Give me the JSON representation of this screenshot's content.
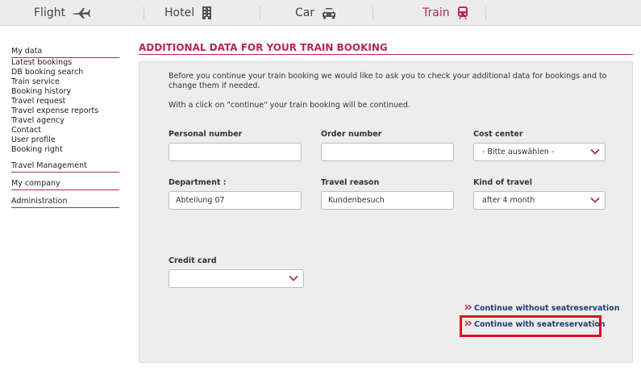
{
  "topnav": {
    "tabs": [
      {
        "label": "Flight",
        "icon": "airplane-icon",
        "active": false
      },
      {
        "label": "Hotel",
        "icon": "building-icon",
        "active": false
      },
      {
        "label": "Car",
        "icon": "car-icon",
        "active": false
      },
      {
        "label": "Train",
        "icon": "train-icon",
        "active": true
      }
    ]
  },
  "sidebar": {
    "my_data": "My data",
    "items": [
      "Latest bookings",
      "DB booking search",
      "Train service",
      "Booking history",
      "Travel request",
      "Travel expense reports",
      "Travel agency",
      "Contact",
      "User profile",
      "Booking right"
    ],
    "travel_management": "Travel Management",
    "my_company": "My company",
    "administration": "Administration"
  },
  "main": {
    "title": "ADDITIONAL DATA FOR YOUR TRAIN BOOKING",
    "intro": "Before you continue your train booking we would like to ask you to check your additional data for bookings and to change them if needed.",
    "intro2": "With a click on \"continue\" your train booking will be continued.",
    "fields": {
      "personal_number": {
        "label": "Personal number",
        "value": ""
      },
      "order_number": {
        "label": "Order number",
        "value": ""
      },
      "cost_center": {
        "label": "Cost center",
        "value": "- Bitte auswählen -"
      },
      "department": {
        "label": "Department :",
        "value": "Abteilung 07"
      },
      "travel_reason": {
        "label": "Travel reason",
        "value": "Kundenbesuch"
      },
      "kind_of_travel": {
        "label": "Kind of travel",
        "value": "after 4 month"
      },
      "credit_card": {
        "label": "Credit card",
        "value": ""
      }
    },
    "links": {
      "without_seat": "Continue without seatreservation",
      "with_seat": "Continue with seatreservation"
    }
  },
  "colors": {
    "accent": "#b2285a",
    "link": "#1f3d7a",
    "highlight": "#e0101c",
    "panel": "#ededed"
  }
}
